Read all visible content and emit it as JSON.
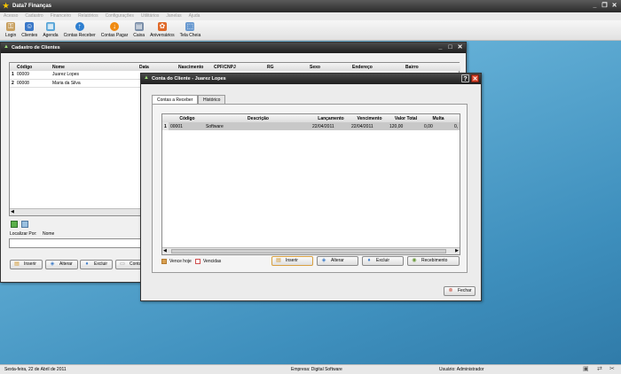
{
  "app": {
    "title": "Data7 Finanças",
    "icon": "star-icon",
    "window_buttons": [
      "minimize-icon",
      "restore-icon",
      "close-icon"
    ]
  },
  "menu": [
    "Acesso",
    "Cadastro",
    "Financeiro",
    "Relatórios",
    "Configurações",
    "Utilitários",
    "Janelas",
    "Ajuda"
  ],
  "toolbar": [
    {
      "label": "Login",
      "icon": "key-icon",
      "color": "#c8a060"
    },
    {
      "label": "Clientes",
      "icon": "users-icon",
      "color": "#3a78c8"
    },
    {
      "label": "Agenda",
      "icon": "calendar-icon",
      "color": "#5aa6d8"
    },
    {
      "label": "Contas Receber",
      "icon": "arrow-up-icon",
      "color": "#2e7fd0"
    },
    {
      "label": "Contas Pagar",
      "icon": "arrow-down-icon",
      "color": "#f08a10"
    },
    {
      "label": "Caixa",
      "icon": "cash-register-icon",
      "color": "#7a8ea8"
    },
    {
      "label": "Aniversários",
      "icon": "gift-icon",
      "color": "#e06a2a"
    },
    {
      "label": "Tela Cheia",
      "icon": "fullscreen-icon",
      "color": "#6a9ad0"
    }
  ],
  "cadastro": {
    "title": "Cadastro de Clientes",
    "columns": [
      "Código",
      "Nome",
      "Data",
      "Nascimento",
      "CPF/CNPJ",
      "RG",
      "Sexo",
      "Endereço",
      "Bairro"
    ],
    "rows": [
      {
        "index": "1",
        "codigo": "00009",
        "nome": "Juarez Lopes"
      },
      {
        "index": "2",
        "codigo": "00008",
        "nome": "Maria da Silva"
      }
    ],
    "localizar_label": "Localizar Por:",
    "localizar_value": "Nome",
    "buttons": {
      "inserir": "Inserir",
      "alterar": "Alterar",
      "excluir": "Excluir",
      "contas": "Conta"
    }
  },
  "conta": {
    "title": "Conta do Cliente - Juarez Lopes",
    "tabs": [
      "Contas a Receber",
      "Histórico"
    ],
    "columns": [
      "Código",
      "Descrição",
      "Lançamento",
      "Vencimento",
      "Valor Total",
      "Multa"
    ],
    "rows": [
      {
        "index": "1",
        "codigo": "00001",
        "descricao": "Software",
        "lancamento": "22/04/2011",
        "vencimento": "22/04/2011",
        "valor_total": "120,00",
        "multa": "0,00",
        "extra": "0,"
      }
    ],
    "legend": {
      "vence_hoje": "Vence hoje",
      "vencidas": "Vencidas"
    },
    "buttons": {
      "inserir": "Inserir",
      "alterar": "Alterar",
      "excluir": "Excluir",
      "recebimento": "Recebimento",
      "fechar": "Fechar"
    }
  },
  "status": {
    "date": "Sexta-feira, 22 de Abril de 2011",
    "empresa": "Empresa: Digital Software",
    "usuario": "Usuário: Administrador"
  },
  "colors": {
    "selected_row": "#c8c8c8",
    "vence_hoje": "#d8a050",
    "vencidas": "#d05050",
    "close_red": "#d6452c"
  }
}
